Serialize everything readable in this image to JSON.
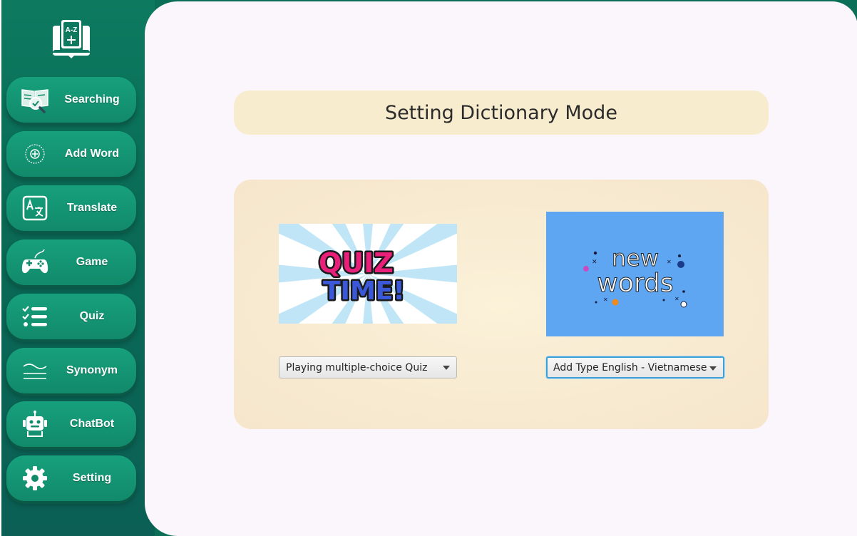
{
  "sidebar": {
    "logo_text": "A-Z",
    "items": [
      {
        "label": "Searching",
        "icon": "book-search-icon"
      },
      {
        "label": "Add Word",
        "icon": "add-circle-icon"
      },
      {
        "label": "Translate",
        "icon": "translate-icon"
      },
      {
        "label": "Game",
        "icon": "gamepad-icon"
      },
      {
        "label": "Quiz",
        "icon": "checklist-icon"
      },
      {
        "label": "Synonym",
        "icon": "synonym-lines-icon"
      },
      {
        "label": "ChatBot",
        "icon": "robot-icon"
      },
      {
        "label": "Setting",
        "icon": "gear-icon"
      }
    ]
  },
  "main": {
    "title": "Setting Dictionary Mode",
    "quiz_image": {
      "line1": "QUIZ",
      "line2": "TIME!"
    },
    "words_image": {
      "line1": "new",
      "line2": "words"
    },
    "quiz_select": {
      "value": "Playing multiple-choice Quiz"
    },
    "words_select": {
      "value": "Add Type English - Vietnamese"
    }
  },
  "colors": {
    "sidebar_bg": "#0b6e57",
    "nav_button": "#17a07c",
    "main_bg": "#fbf6fb",
    "panel_bg": "#f8ecce",
    "words_bg": "#5ea6f2",
    "focus_ring": "#3ea0d6"
  }
}
